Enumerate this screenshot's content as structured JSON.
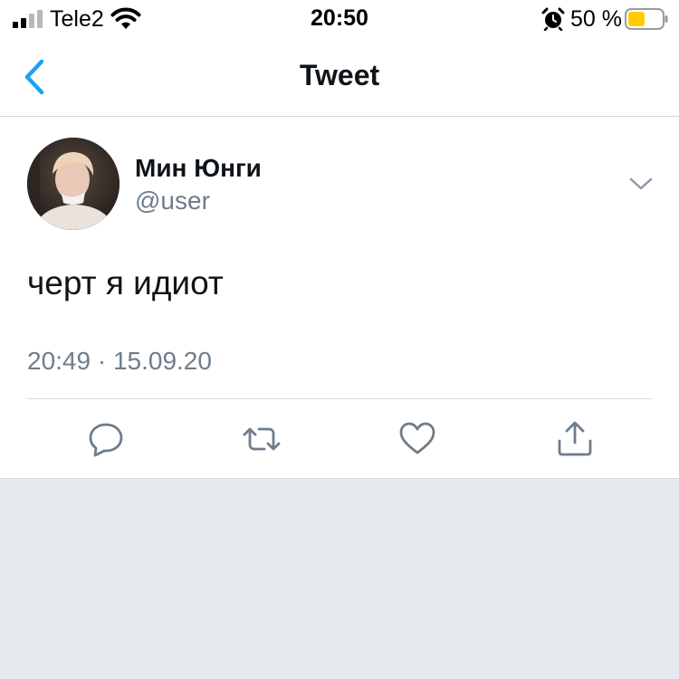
{
  "status_bar": {
    "carrier": "Tele2",
    "time": "20:50",
    "battery_percent": "50 %",
    "battery_level": 0.5,
    "icons": [
      "signal-icon",
      "wifi-icon",
      "alarm-icon",
      "battery-icon"
    ]
  },
  "nav": {
    "title": "Tweet",
    "back_icon": "chevron-left-icon"
  },
  "tweet": {
    "display_name": "Мин Юнги",
    "handle": "@user",
    "text": "черт я идиот",
    "timestamp": "20:49 · 15.09.20"
  },
  "actions": [
    {
      "icon": "reply-icon"
    },
    {
      "icon": "retweet-icon"
    },
    {
      "icon": "like-icon"
    },
    {
      "icon": "share-icon"
    }
  ],
  "colors": {
    "accent": "#1da1f2",
    "secondary_text": "#6e7d8c",
    "battery_fill": "#ffcc00",
    "background": "#e6e9ee"
  }
}
